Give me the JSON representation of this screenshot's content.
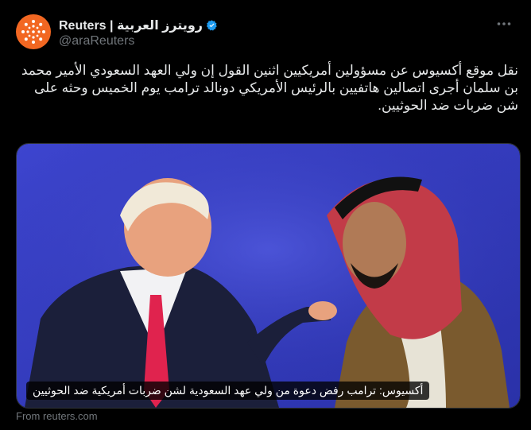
{
  "author": {
    "name": "Reuters | رويترز العربية",
    "handle": "@araReuters",
    "verified": true
  },
  "tweet": {
    "text": "نقل موقع أكسيوس عن مسؤولين أمريكيين اثنين القول إن ولي العهد السعودي الأمير محمد بن سلمان أجرى اتصالين هاتفيين بالرئيس الأمريكي دونالد ترامب يوم الخميس وحثه على شن ضربات ضد الحوثيين."
  },
  "media": {
    "caption": "أكسيوس: ترامب رفض دعوة من ولي عهد السعودية لشن ضربات أمريكية ضد الحوثيين"
  },
  "source": "From reuters.com",
  "icons": {
    "avatar": "reuters-logo-icon",
    "verified": "verified-badge-icon",
    "more": "more-options-icon"
  },
  "colors": {
    "background": "#000000",
    "text": "#e7e9ea",
    "muted": "#71767b",
    "brand": "#f26722",
    "verified": "#1d9bf0",
    "photo_backdrop": "#3a41c8"
  }
}
